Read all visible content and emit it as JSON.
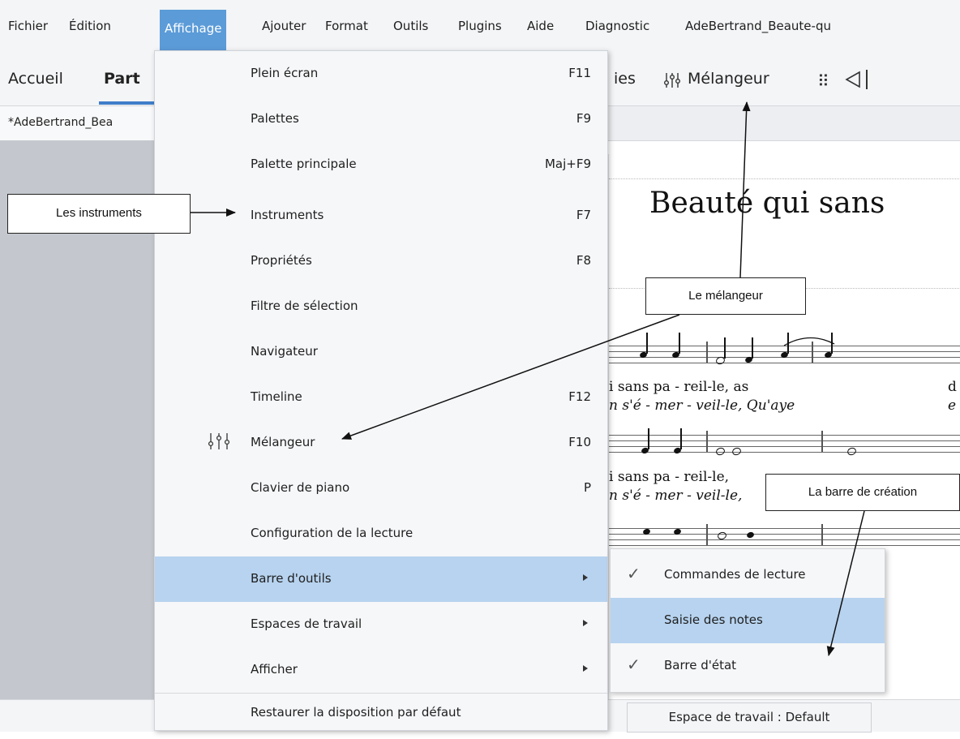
{
  "menubar": {
    "items": [
      "Fichier",
      "Édition",
      "Affichage",
      "Ajouter",
      "Format",
      "Outils",
      "Plugins",
      "Aide",
      "Diagnostic",
      "AdeBertrand_Beaute-qu"
    ]
  },
  "tabs": {
    "accueil": "Accueil",
    "partition": "Part",
    "right_partial": "ies",
    "melangeur": "Mélangeur"
  },
  "document_tab": "*AdeBertrand_Bea",
  "score": {
    "title": "Beauté qui sans",
    "lyrics": [
      {
        "text": "i sans pa - reil-le,    as",
        "extra": "d",
        "italic": false
      },
      {
        "text": "n  s'é - mer - veil-le, Qu'aye",
        "extra": "e",
        "italic": true
      },
      {
        "text": "i sans  pa - reil-le,",
        "extra": "",
        "italic": false
      },
      {
        "text": "n  s'é - mer - veil-le,",
        "extra": "",
        "italic": true
      }
    ]
  },
  "affichage_menu": {
    "items": [
      {
        "label": "Plein écran",
        "shortcut": "F11",
        "submenu": false
      },
      {
        "label": "Palettes",
        "shortcut": "F9",
        "submenu": false
      },
      {
        "label": "Palette principale",
        "shortcut": "Maj+F9",
        "submenu": false
      },
      {
        "label": "Instruments",
        "shortcut": "F7",
        "submenu": false
      },
      {
        "label": "Propriétés",
        "shortcut": "F8",
        "submenu": false
      },
      {
        "label": "Filtre de sélection",
        "shortcut": "",
        "submenu": false
      },
      {
        "label": "Navigateur",
        "shortcut": "",
        "submenu": false
      },
      {
        "label": "Timeline",
        "shortcut": "F12",
        "submenu": false
      },
      {
        "label": "Mélangeur",
        "shortcut": "F10",
        "submenu": false,
        "icon": "mixer-icon"
      },
      {
        "label": "Clavier de piano",
        "shortcut": "P",
        "submenu": false
      },
      {
        "label": "Configuration de la lecture",
        "shortcut": "",
        "submenu": false
      },
      {
        "label": "Barre d'outils",
        "shortcut": "",
        "submenu": true,
        "highlighted": true
      },
      {
        "label": "Espaces de travail",
        "shortcut": "",
        "submenu": true
      },
      {
        "label": "Afficher",
        "shortcut": "",
        "submenu": true
      },
      {
        "label": "Restaurer la disposition par défaut",
        "shortcut": "",
        "submenu": false
      }
    ]
  },
  "toolbar_submenu": {
    "items": [
      {
        "label": "Commandes de lecture",
        "checked": true,
        "highlighted": false
      },
      {
        "label": "Saisie des notes",
        "checked": false,
        "highlighted": true
      },
      {
        "label": "Barre d'état",
        "checked": true,
        "highlighted": false
      }
    ]
  },
  "status_bar": {
    "workspace": "Espace de travail : Default"
  },
  "callouts": {
    "instruments": "Les instruments",
    "melangeur": "Le mélangeur",
    "barre_creation": "La barre de création"
  },
  "colors": {
    "menu_active": "#5b9bd8",
    "menu_highlight": "#b7d3ef",
    "tab_underline": "#3f7ec9"
  }
}
